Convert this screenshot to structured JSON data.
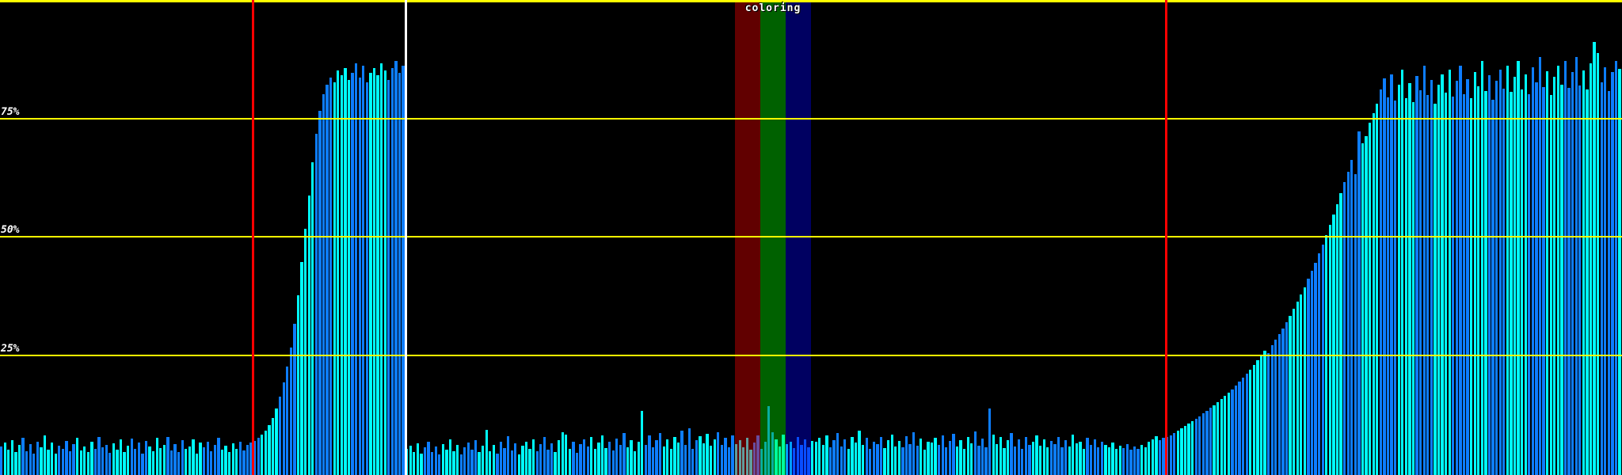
{
  "labels": {
    "y75": "75%",
    "y50": "50%",
    "y25": "25%"
  },
  "overlay": {
    "label": "coloring"
  },
  "palette": {
    "background": "#000000",
    "bar_cyan": "#00ffff",
    "bar_blue": "#0d7dff",
    "grid_yellow": "#ffff00",
    "marker_red": "#ff0000",
    "marker_white": "#ffffff",
    "band_red": "rgba(255,0,0,0.38)",
    "band_green": "rgba(0,255,0,0.38)",
    "band_blue": "rgba(0,0,255,0.38)",
    "label_white": "#ffffff"
  },
  "chart_data": {
    "type": "bar",
    "title": "",
    "xlabel": "",
    "ylabel": "",
    "y_axis": {
      "unit": "%",
      "range": [
        0,
        100
      ],
      "ticks": [
        {
          "label": "75%",
          "percent": 75
        },
        {
          "label": "50%",
          "percent": 50
        },
        {
          "label": "25%",
          "percent": 25
        }
      ],
      "gridlines_percent": [
        100,
        75,
        50,
        25
      ],
      "grid": true
    },
    "legend": null,
    "markers": {
      "red_vertical_lines_x_frac": [
        0.1558,
        0.7188
      ],
      "white_vertical_line_x_frac": 0.25
    },
    "coloring_bands": [
      {
        "name": "red",
        "x_frac": 0.4531,
        "w_frac": 0.015625
      },
      {
        "name": "green",
        "x_frac": 0.46875,
        "w_frac": 0.015625
      },
      {
        "name": "blue",
        "x_frac": 0.484375,
        "w_frac": 0.015625
      }
    ],
    "bar_pitch_frac": 0.00223214,
    "bar_width_frac": 0.00161,
    "bars_percent": [
      6.0,
      6.9,
      5.4,
      7.4,
      4.9,
      6.3,
      7.8,
      5.1,
      6.5,
      4.6,
      7.1,
      5.8,
      8.3,
      5.3,
      6.8,
      4.5,
      6.2,
      5.6,
      7.2,
      5.0,
      6.6,
      7.9,
      5.2,
      6.1,
      4.8,
      7.0,
      5.5,
      8.1,
      5.9,
      6.4,
      4.7,
      6.7,
      5.3,
      7.5,
      4.9,
      6.2,
      7.7,
      5.6,
      6.9,
      4.5,
      7.2,
      6.0,
      5.1,
      7.8,
      5.7,
      6.3,
      8.0,
      5.2,
      6.6,
      4.8,
      7.3,
      5.5,
      6.1,
      7.6,
      4.6,
      6.8,
      5.9,
      7.1,
      5.0,
      6.4,
      7.9,
      5.4,
      6.2,
      4.9,
      6.7,
      5.6,
      7.0,
      5.2,
      6.3,
      6.9,
      7.2,
      7.8,
      8.5,
      9.4,
      10.5,
      12.0,
      14.0,
      16.5,
      19.5,
      23.0,
      27.0,
      32.0,
      38.0,
      45.0,
      52.0,
      59.0,
      66.0,
      72.0,
      77.0,
      80.5,
      82.5,
      84.0,
      83.0,
      85.5,
      84.5,
      86.0,
      83.5,
      85.0,
      87.0,
      84.0,
      86.5,
      83.0,
      85.0,
      86.0,
      84.5,
      87.0,
      85.5,
      83.5,
      86.0,
      87.5,
      85.0,
      86.5,
      5.5,
      6.2,
      4.9,
      6.7,
      4.6,
      5.8,
      7.0,
      4.8,
      6.0,
      4.4,
      6.5,
      5.4,
      7.6,
      5.0,
      6.3,
      4.3,
      5.9,
      6.8,
      5.3,
      7.3,
      4.8,
      6.2,
      9.5,
      5.0,
      6.4,
      4.5,
      7.0,
      5.7,
      8.2,
      5.2,
      6.7,
      4.4,
      6.2,
      7.1,
      5.6,
      7.6,
      5.1,
      6.5,
      8.0,
      5.3,
      6.7,
      4.8,
      7.3,
      9.0,
      8.5,
      5.5,
      7.0,
      4.7,
      6.6,
      7.5,
      6.0,
      8.0,
      5.5,
      6.9,
      8.4,
      5.7,
      7.1,
      5.2,
      7.7,
      6.4,
      8.9,
      5.9,
      7.4,
      5.1,
      7.0,
      13.5,
      6.4,
      8.4,
      5.9,
      7.3,
      8.8,
      6.1,
      7.5,
      5.6,
      8.1,
      6.8,
      9.3,
      6.3,
      9.8,
      5.5,
      7.3,
      8.2,
      6.7,
      8.7,
      6.2,
      7.6,
      9.1,
      6.4,
      7.8,
      5.9,
      8.4,
      6.5,
      7.4,
      5.9,
      7.9,
      5.4,
      6.8,
      8.3,
      5.6,
      7.0,
      14.5,
      9.0,
      7.6,
      6.1,
      8.6,
      6.6,
      7.1,
      5.7,
      8.0,
      6.3,
      7.5,
      5.8,
      7.2,
      7.0,
      7.9,
      6.4,
      8.4,
      5.9,
      7.3,
      8.8,
      6.1,
      7.5,
      5.6,
      8.1,
      6.8,
      9.3,
      6.3,
      7.8,
      5.5,
      7.1,
      6.5,
      8.0,
      5.7,
      7.4,
      8.6,
      6.0,
      7.2,
      5.8,
      8.2,
      6.6,
      9.0,
      6.2,
      7.7,
      5.4,
      7.0,
      6.9,
      7.8,
      6.3,
      8.3,
      5.8,
      7.2,
      8.7,
      6.0,
      7.4,
      5.5,
      8.0,
      6.7,
      9.2,
      6.2,
      7.7,
      5.9,
      14.0,
      8.5,
      6.6,
      8.1,
      5.7,
      7.3,
      8.8,
      6.1,
      7.5,
      5.6,
      8.1,
      6.4,
      7.0,
      8.4,
      6.2,
      7.6,
      5.8,
      7.2,
      6.6,
      8.0,
      5.9,
      7.4,
      6.1,
      8.5,
      6.7,
      7.1,
      5.6,
      7.9,
      6.3,
      7.5,
      5.9,
      7.0,
      6.4,
      5.8,
      6.9,
      5.5,
      6.2,
      5.7,
      6.6,
      5.3,
      6.0,
      5.6,
      6.4,
      5.9,
      7.0,
      7.6,
      8.2,
      7.4,
      7.9,
      8.0,
      8.4,
      8.9,
      9.3,
      9.8,
      10.3,
      10.8,
      11.3,
      11.9,
      12.4,
      13.0,
      13.6,
      14.2,
      14.8,
      15.4,
      16.0,
      16.7,
      17.4,
      18.1,
      18.9,
      19.7,
      20.5,
      21.4,
      22.3,
      23.2,
      24.2,
      25.2,
      26.3,
      25.8,
      27.4,
      28.6,
      29.8,
      31.0,
      32.3,
      33.7,
      35.1,
      36.6,
      38.1,
      39.7,
      41.4,
      43.1,
      44.9,
      46.8,
      48.7,
      50.7,
      52.8,
      55.0,
      57.2,
      59.5,
      61.8,
      64.0,
      66.5,
      63.5,
      72.5,
      70.0,
      71.5,
      74.5,
      76.5,
      78.5,
      81.5,
      83.8,
      79.8,
      84.7,
      79.1,
      82.4,
      85.6,
      79.6,
      82.8,
      78.7,
      84.3,
      81.2,
      86.5,
      80.2,
      83.5,
      78.4,
      82.4,
      84.7,
      80.7,
      85.6,
      80.0,
      83.3,
      86.5,
      80.5,
      83.7,
      79.6,
      85.2,
      82.1,
      87.4,
      81.1,
      84.4,
      79.3,
      83.3,
      85.6,
      81.6,
      86.5,
      80.9,
      84.2,
      87.4,
      81.4,
      84.6,
      80.5,
      86.1,
      83.0,
      88.3,
      82.0,
      85.3,
      80.2,
      84.2,
      86.5,
      82.5,
      87.4,
      81.8,
      85.1,
      88.3,
      82.3,
      85.5,
      81.4,
      87.0,
      91.5,
      89.2,
      82.9,
      86.2,
      81.1,
      85.1,
      87.4,
      85.8
    ]
  }
}
